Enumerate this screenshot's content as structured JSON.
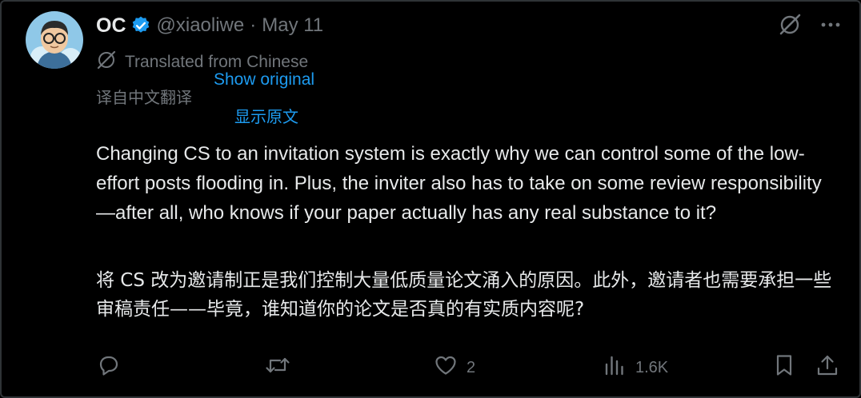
{
  "author": {
    "name": "OC",
    "handle": "@xiaoliwe",
    "separator": "·",
    "date": "May 11",
    "verified_color": "#1d9bf0"
  },
  "translation": {
    "label": "Translated from Chinese",
    "label_zh": "译自中文翻译",
    "show_original": "Show original",
    "show_original_zh": "显示原文"
  },
  "tweet": {
    "text_en": "Changing CS to an invitation system is exactly why we can control some of the low-effort posts flooding in. Plus, the inviter also has to take on some review responsibility—after all, who knows if your paper actually has any real substance to it?",
    "text_zh": "将 CS 改为邀请制正是我们控制大量低质量论文涌入的原因。此外，邀请者也需要承担一些审稿责任——毕竟，谁知道你的论文是否真的有实质内容呢?"
  },
  "actions": {
    "reply_count": "",
    "retweet_count": "",
    "like_count": "2",
    "views_count": "1.6K"
  },
  "icons": {
    "top_right": [
      "grok-icon",
      "more-icon"
    ],
    "action_bar": [
      "reply-icon",
      "retweet-icon",
      "like-icon",
      "views-icon",
      "bookmark-icon",
      "share-icon"
    ]
  },
  "colors": {
    "background": "#000000",
    "text": "#e7e9ea",
    "muted": "#71767b",
    "link": "#1d9bf0"
  }
}
